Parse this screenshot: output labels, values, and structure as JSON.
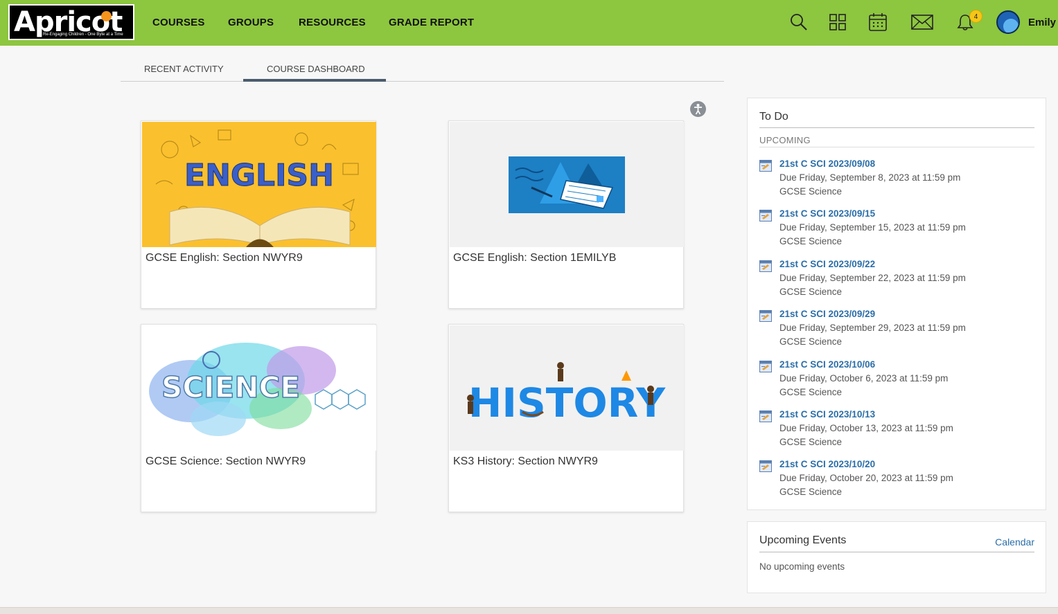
{
  "header": {
    "logo_text": "Apricot",
    "logo_tagline": "Re-Engaging Children - One Byte at a Time",
    "nav": [
      "COURSES",
      "GROUPS",
      "RESOURCES",
      "GRADE REPORT"
    ],
    "notification_count": "4",
    "user_name": "Emily",
    "icons": [
      "search-icon",
      "apps-grid-icon",
      "calendar-icon",
      "mail-icon",
      "bell-icon"
    ],
    "accent_color": "#8dc63f"
  },
  "tabs": [
    {
      "label": "RECENT ACTIVITY",
      "active": false
    },
    {
      "label": "COURSE DASHBOARD",
      "active": true
    }
  ],
  "courses": [
    {
      "title": "GCSE English: Section NWYR9",
      "image_word": "ENGLISH"
    },
    {
      "title": "GCSE English: Section 1EMILYB",
      "image_word": ""
    },
    {
      "title": "GCSE Science: Section NWYR9",
      "image_word": "SCIENCE"
    },
    {
      "title": "KS3 History: Section NWYR9",
      "image_word": "HISTORY"
    }
  ],
  "todo": {
    "title": "To Do",
    "section_label": "UPCOMING",
    "items": [
      {
        "title": "21st C SCI 2023/09/08",
        "due": "Due Friday, September 8, 2023 at 11:59 pm",
        "course": "GCSE Science"
      },
      {
        "title": "21st C SCI 2023/09/15",
        "due": "Due Friday, September 15, 2023 at 11:59 pm",
        "course": "GCSE Science"
      },
      {
        "title": "21st C SCI 2023/09/22",
        "due": "Due Friday, September 22, 2023 at 11:59 pm",
        "course": "GCSE Science"
      },
      {
        "title": "21st C SCI 2023/09/29",
        "due": "Due Friday, September 29, 2023 at 11:59 pm",
        "course": "GCSE Science"
      },
      {
        "title": "21st C SCI 2023/10/06",
        "due": "Due Friday, October 6, 2023 at 11:59 pm",
        "course": "GCSE Science"
      },
      {
        "title": "21st C SCI 2023/10/13",
        "due": "Due Friday, October 13, 2023 at 11:59 pm",
        "course": "GCSE Science"
      },
      {
        "title": "21st C SCI 2023/10/20",
        "due": "Due Friday, October 20, 2023 at 11:59 pm",
        "course": "GCSE Science"
      }
    ]
  },
  "events": {
    "title": "Upcoming Events",
    "calendar_link": "Calendar",
    "empty_text": "No upcoming events"
  }
}
